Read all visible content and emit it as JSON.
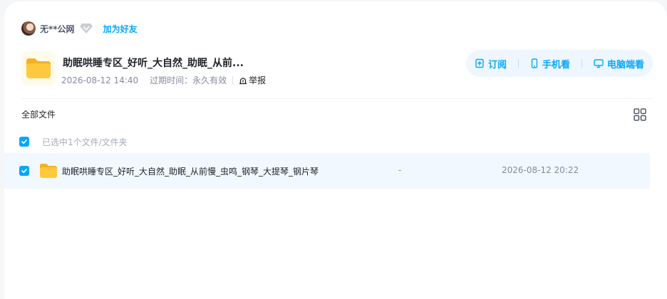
{
  "colors": {
    "accent": "#06a7ff",
    "row_selected_bg": "#f1f8ff",
    "actions_bg": "#eef7ff",
    "folder": "#ffc83d"
  },
  "sharer": {
    "name": "无**公网",
    "add_friend_label": "加为好友",
    "badge_icon": "diamond-vip-icon"
  },
  "share": {
    "title": "助眠哄睡专区_好听_大自然_助眠_从前...",
    "created_at": "2026-08-12 14:40",
    "expire_label": "过期时间：",
    "expire_value": "永久有效",
    "report_label": "举报"
  },
  "actions": [
    {
      "label": "订阅",
      "icon": "subscribe-icon"
    },
    {
      "label": "手机看",
      "icon": "phone-icon"
    },
    {
      "label": "电脑端看",
      "icon": "monitor-icon"
    }
  ],
  "breadcrumb": {
    "root": "全部文件"
  },
  "selection": {
    "status": "已选中1个文件/文件夹"
  },
  "files": [
    {
      "name": "助眠哄睡专区_好听_大自然_助眠_从前慢_虫鸣_钢琴_大提琴_钢片琴",
      "size": "-",
      "modified": "2026-08-12 20:22",
      "selected": true,
      "icon": "folder-icon"
    }
  ]
}
